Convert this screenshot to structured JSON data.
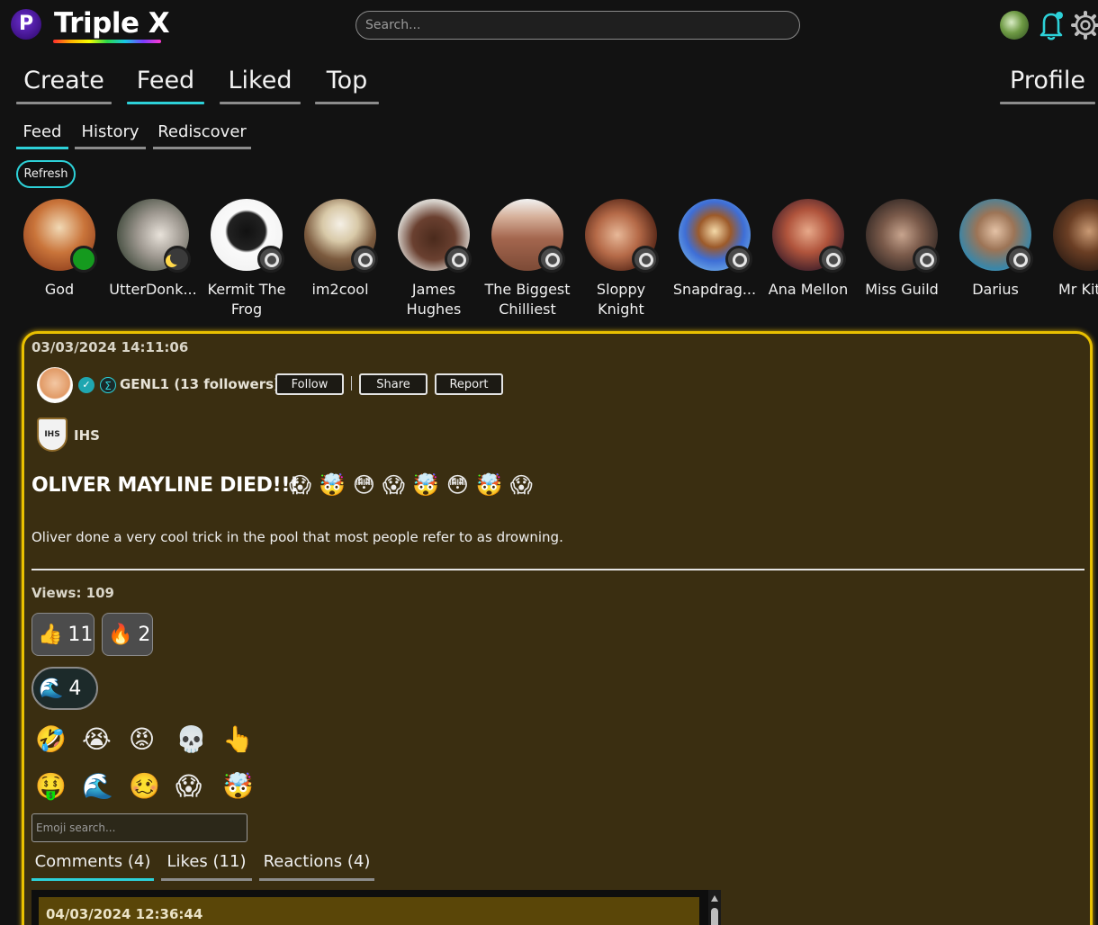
{
  "header": {
    "logo_letter": "P",
    "brand": "Triple X",
    "search_placeholder": "Search..."
  },
  "main_tabs": [
    {
      "label": "Create"
    },
    {
      "label": "Feed",
      "active": true
    },
    {
      "label": "Liked"
    },
    {
      "label": "Top"
    },
    {
      "label": "Profile"
    }
  ],
  "sub_tabs": [
    {
      "label": "Feed",
      "active": true
    },
    {
      "label": "History"
    },
    {
      "label": "Rediscover"
    }
  ],
  "refresh_label": "Refresh",
  "stories": [
    {
      "name": "God",
      "badge": "online"
    },
    {
      "name": "UtterDonk...",
      "badge": "moon"
    },
    {
      "name": "Kermit The Frog",
      "badge": "offline"
    },
    {
      "name": "im2cool",
      "badge": "offline"
    },
    {
      "name": "James Hughes",
      "badge": "offline"
    },
    {
      "name": "The Biggest Chilliest",
      "badge": "offline"
    },
    {
      "name": "Sloppy Knight",
      "badge": "offline"
    },
    {
      "name": "Snapdrag...",
      "badge": "offline"
    },
    {
      "name": "Ana Mellon",
      "badge": "offline"
    },
    {
      "name": "Miss Guild",
      "badge": "offline"
    },
    {
      "name": "Darius",
      "badge": "offline"
    },
    {
      "name": "Mr Kit",
      "badge": "offline"
    }
  ],
  "post": {
    "date": "03/03/2024 14:11:06",
    "author": "GENL1 (13 followers)",
    "follow_label": "Follow",
    "share_label": "Share",
    "report_label": "Report",
    "group_logo_text": "IHS",
    "group": "IHS",
    "title": "OLIVER MAYLINE DIED!!!",
    "title_emojis": "😱🤯😳😱🤯😳🤯😱",
    "body": "Oliver done a very cool trick in the pool that most people refer to as drowning.",
    "views": "Views: 109",
    "reactions": [
      {
        "emoji": "👍",
        "count": "11"
      },
      {
        "emoji": "🔥",
        "count": "2"
      },
      {
        "emoji": "🌊",
        "count": "4"
      }
    ],
    "picker_row1": [
      "🤣",
      "😭",
      "😡",
      "💀",
      "👆"
    ],
    "picker_row2": [
      "🤑",
      "🌊",
      "🥴",
      "😱",
      "🤯"
    ],
    "emoji_search_placeholder": "Emoji search...",
    "comment_tabs": [
      {
        "label": "Comments (4)",
        "active": true
      },
      {
        "label": "Likes (11)"
      },
      {
        "label": "Reactions (4)"
      }
    ],
    "first_comment_date": "04/03/2024 12:36:44"
  }
}
